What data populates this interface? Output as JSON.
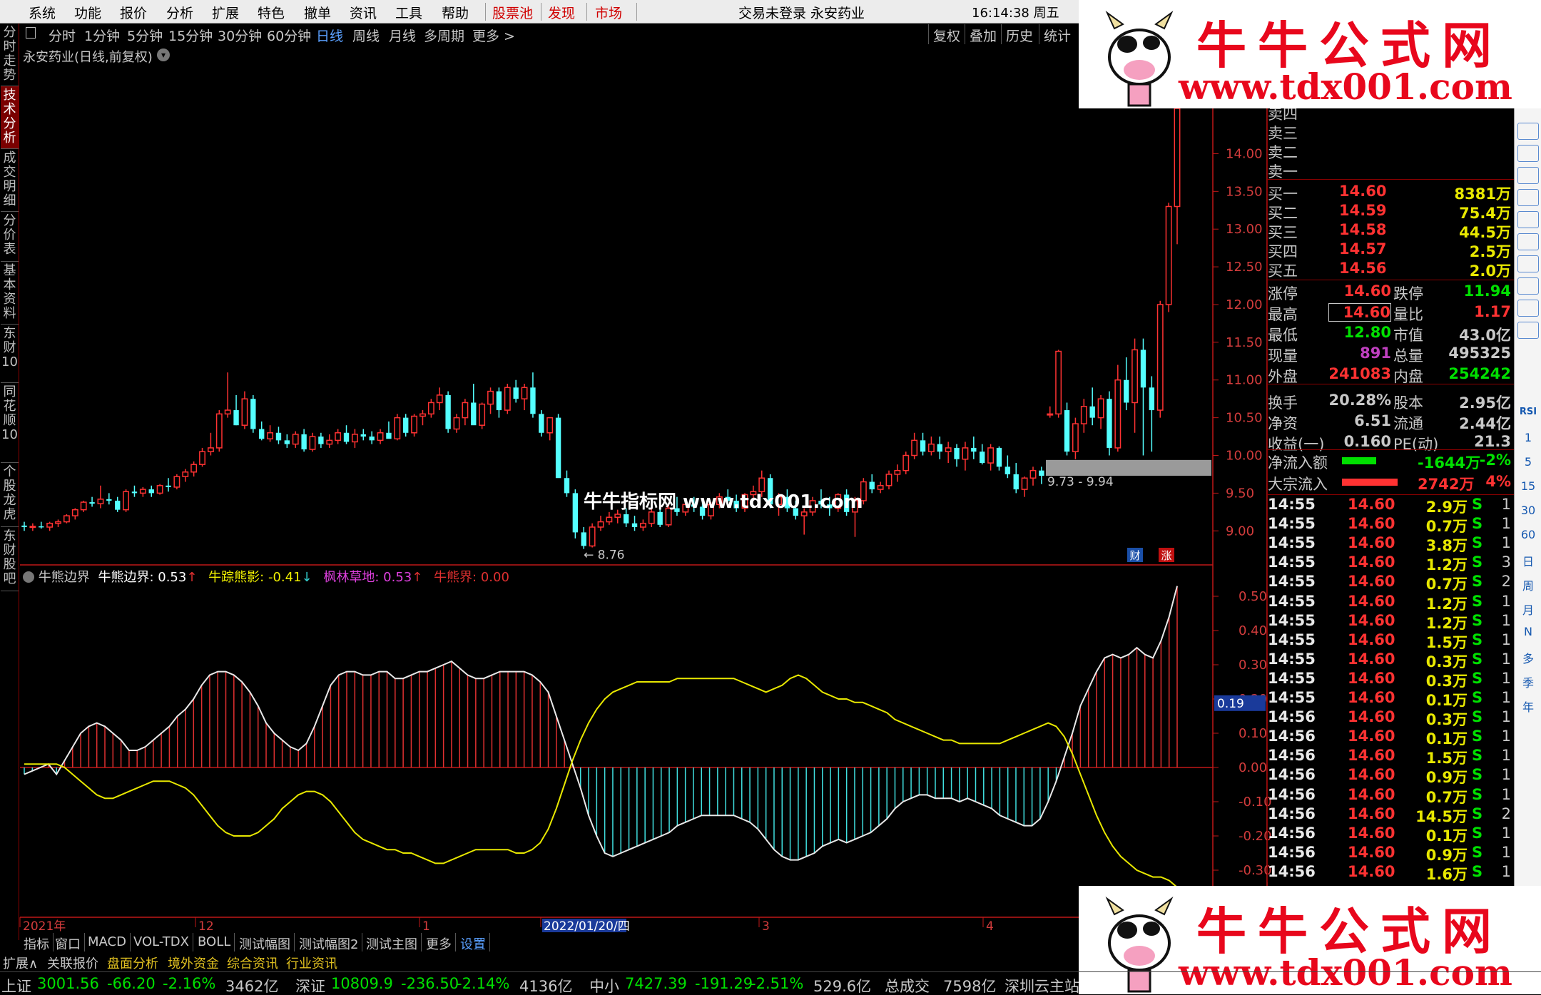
{
  "menu": {
    "items": [
      "系统",
      "功能",
      "报价",
      "分析",
      "扩展",
      "特色",
      "撤单",
      "资讯",
      "工具",
      "帮助"
    ],
    "red_items": [
      "股票池",
      "发现",
      "市场"
    ],
    "title": "交易未登录 永安药业",
    "clock": "16:14:38 周五"
  },
  "periods": [
    "分时",
    "1分钟",
    "5分钟",
    "15分钟",
    "30分钟",
    "60分钟",
    "日线",
    "周线",
    "月线",
    "多周期",
    "更多 >"
  ],
  "active_period": "日线",
  "toolbar_right": [
    "复权",
    "叠加",
    "历史",
    "统计"
  ],
  "left_tabs": [
    "分时走势",
    "技术分析",
    "成交明细",
    "分价表",
    "基本资料",
    "东财10",
    "同花顺10",
    "个股龙虎",
    "东财股吧"
  ],
  "stock_title": "永安药业(日线,前复权)",
  "price_axis": [
    "14.00",
    "13.50",
    "13.00",
    "12.50",
    "12.00",
    "11.50",
    "11.00",
    "10.50",
    "10.00",
    "9.50",
    "9.00"
  ],
  "indicator": {
    "name": "牛熊边界",
    "items": [
      {
        "label": "牛熊边界: 0.53",
        "arrow": "↑"
      },
      {
        "label": "牛踪熊影: -0.41",
        "arrow": "↓"
      },
      {
        "label": "枫林草地: 0.53",
        "arrow": "↑"
      },
      {
        "label": "牛熊界: 0.00",
        "arrow": ""
      }
    ]
  },
  "ind_axis": [
    "0.50",
    "0.40",
    "0.30",
    "0.20",
    "0.10",
    "0.00",
    "-0.10",
    "-0.20",
    "-0.30"
  ],
  "ind_marker": "0.19",
  "low_label": "← 8.76",
  "range_label": "9.73 - 9.94",
  "chart_overlay": "牛牛指标网 www.tdx001.com",
  "badges": {
    "cai": "财",
    "zhang": "涨"
  },
  "date_axis": [
    "2021年",
    "12",
    "1",
    "2022/01/20/四",
    "3",
    "4"
  ],
  "bottom_tabs": [
    "指标",
    "窗口",
    "MACD",
    "VOL-TDX",
    "BOLL",
    "测试幅图",
    "测试幅图2",
    "测试主图",
    "更多",
    "设置"
  ],
  "bottom_tabs2": [
    "扩展∧",
    "关联报价",
    "盘面分析",
    "境外资金",
    "综合资讯",
    "行业资讯"
  ],
  "sell_labels": [
    "卖四",
    "卖三",
    "卖二",
    "卖一"
  ],
  "buy": [
    {
      "label": "买一",
      "price": "14.60",
      "vol": "8381万"
    },
    {
      "label": "买二",
      "price": "14.59",
      "vol": "75.4万"
    },
    {
      "label": "买三",
      "price": "14.58",
      "vol": "44.5万"
    },
    {
      "label": "买四",
      "price": "14.57",
      "vol": "2.5万"
    },
    {
      "label": "买五",
      "price": "14.56",
      "vol": "2.0万"
    }
  ],
  "stats": [
    {
      "l1": "涨停",
      "v1": "14.60",
      "l2": "跌停",
      "v2": "11.94"
    },
    {
      "l1": "最高",
      "v1": "14.60",
      "l2": "量比",
      "v2": "1.17"
    },
    {
      "l1": "最低",
      "v1": "12.80",
      "l2": "市值",
      "v2": "43.0亿"
    },
    {
      "l1": "现量",
      "v1": "891",
      "l2": "总量",
      "v2": "495325"
    },
    {
      "l1": "外盘",
      "v1": "241083",
      "l2": "内盘",
      "v2": "254242"
    },
    {
      "l1": "换手",
      "v1": "20.28%",
      "l2": "股本",
      "v2": "2.95亿"
    },
    {
      "l1": "净资",
      "v1": "6.51",
      "l2": "流通",
      "v2": "2.44亿"
    },
    {
      "l1": "收益(一)",
      "v1": "0.160",
      "l2": "PE(动)",
      "v2": "21.3"
    }
  ],
  "flows": [
    {
      "label": "净流入额",
      "value": "-1644万",
      "pct": "-2%"
    },
    {
      "label": "大宗流入",
      "value": "2742万",
      "pct": "4%"
    }
  ],
  "ticks": [
    {
      "t": "14:55",
      "p": "14.60",
      "v": "2.9万",
      "s": "S",
      "n": "1"
    },
    {
      "t": "14:55",
      "p": "14.60",
      "v": "0.7万",
      "s": "S",
      "n": "1"
    },
    {
      "t": "14:55",
      "p": "14.60",
      "v": "3.8万",
      "s": "S",
      "n": "1"
    },
    {
      "t": "14:55",
      "p": "14.60",
      "v": "1.2万",
      "s": "S",
      "n": "3"
    },
    {
      "t": "14:55",
      "p": "14.60",
      "v": "0.7万",
      "s": "S",
      "n": "2"
    },
    {
      "t": "14:55",
      "p": "14.60",
      "v": "1.2万",
      "s": "S",
      "n": "1"
    },
    {
      "t": "14:55",
      "p": "14.60",
      "v": "1.2万",
      "s": "S",
      "n": "1"
    },
    {
      "t": "14:55",
      "p": "14.60",
      "v": "1.5万",
      "s": "S",
      "n": "1"
    },
    {
      "t": "14:55",
      "p": "14.60",
      "v": "0.3万",
      "s": "S",
      "n": "1"
    },
    {
      "t": "14:55",
      "p": "14.60",
      "v": "0.3万",
      "s": "S",
      "n": "1"
    },
    {
      "t": "14:55",
      "p": "14.60",
      "v": "0.1万",
      "s": "S",
      "n": "1"
    },
    {
      "t": "14:56",
      "p": "14.60",
      "v": "0.3万",
      "s": "S",
      "n": "1"
    },
    {
      "t": "14:56",
      "p": "14.60",
      "v": "0.1万",
      "s": "S",
      "n": "1"
    },
    {
      "t": "14:56",
      "p": "14.60",
      "v": "1.5万",
      "s": "S",
      "n": "1"
    },
    {
      "t": "14:56",
      "p": "14.60",
      "v": "0.9万",
      "s": "S",
      "n": "1"
    },
    {
      "t": "14:56",
      "p": "14.60",
      "v": "0.7万",
      "s": "S",
      "n": "1"
    },
    {
      "t": "14:56",
      "p": "14.60",
      "v": "14.5万",
      "s": "S",
      "n": "2"
    },
    {
      "t": "14:56",
      "p": "14.60",
      "v": "0.1万",
      "s": "S",
      "n": "1"
    },
    {
      "t": "14:56",
      "p": "14.60",
      "v": "0.9万",
      "s": "S",
      "n": "1"
    },
    {
      "t": "14:56",
      "p": "14.60",
      "v": "1.6万",
      "s": "S",
      "n": "1"
    }
  ],
  "right_nav": [
    "RSI",
    "1",
    "5",
    "15",
    "30",
    "60",
    "日",
    "周",
    "月",
    "N",
    "多",
    "季",
    "年"
  ],
  "watermark": {
    "title": "牛牛公式网",
    "url": "www.tdx001.com"
  },
  "status": [
    {
      "name": "上证",
      "val": "3001.56",
      "chg": "-66.20",
      "pct": "-2.16%",
      "amt": "3462亿"
    },
    {
      "name": "深证",
      "val": "10809.9",
      "chg": "-236.50",
      "pct": "-2.14%",
      "amt": "4136亿"
    },
    {
      "name": "中小",
      "val": "7427.39",
      "chg": "-191.29",
      "pct": "-2.51%",
      "amt": "529.6亿"
    }
  ],
  "status_total": {
    "label": "总成交",
    "val": "7598亿"
  },
  "status_server": "深圳云主站",
  "chart_data": {
    "type": "candlestick",
    "title": "永安药业(日线,前复权)",
    "y_range": [
      8.7,
      14.6
    ],
    "candles": [
      [
        9.07,
        9.12,
        9.0,
        9.05
      ],
      [
        9.05,
        9.1,
        9.0,
        9.06
      ],
      [
        9.06,
        9.12,
        9.03,
        9.05
      ],
      [
        9.05,
        9.12,
        9.0,
        9.1
      ],
      [
        9.1,
        9.15,
        9.05,
        9.12
      ],
      [
        9.12,
        9.22,
        9.1,
        9.2
      ],
      [
        9.2,
        9.3,
        9.15,
        9.28
      ],
      [
        9.28,
        9.4,
        9.25,
        9.38
      ],
      [
        9.38,
        9.45,
        9.32,
        9.36
      ],
      [
        9.36,
        9.6,
        9.3,
        9.42
      ],
      [
        9.42,
        9.5,
        9.35,
        9.4
      ],
      [
        9.4,
        9.45,
        9.25,
        9.28
      ],
      [
        9.28,
        9.55,
        9.25,
        9.52
      ],
      [
        9.52,
        9.6,
        9.45,
        9.5
      ],
      [
        9.5,
        9.58,
        9.45,
        9.55
      ],
      [
        9.55,
        9.6,
        9.45,
        9.5
      ],
      [
        9.5,
        9.62,
        9.48,
        9.6
      ],
      [
        9.6,
        9.7,
        9.52,
        9.58
      ],
      [
        9.58,
        9.75,
        9.55,
        9.72
      ],
      [
        9.72,
        9.82,
        9.65,
        9.78
      ],
      [
        9.78,
        9.92,
        9.72,
        9.88
      ],
      [
        9.88,
        10.1,
        9.85,
        10.05
      ],
      [
        10.05,
        10.3,
        10.0,
        10.1
      ],
      [
        10.1,
        10.6,
        10.05,
        10.55
      ],
      [
        10.55,
        11.1,
        10.5,
        10.6
      ],
      [
        10.6,
        10.8,
        10.4,
        10.4
      ],
      [
        10.4,
        10.85,
        10.35,
        10.75
      ],
      [
        10.75,
        10.8,
        10.3,
        10.35
      ],
      [
        10.35,
        10.45,
        10.2,
        10.22
      ],
      [
        10.22,
        10.4,
        10.18,
        10.3
      ],
      [
        10.3,
        10.38,
        10.15,
        10.2
      ],
      [
        10.2,
        10.28,
        10.1,
        10.15
      ],
      [
        10.15,
        10.32,
        10.1,
        10.28
      ],
      [
        10.28,
        10.35,
        10.05,
        10.08
      ],
      [
        10.08,
        10.3,
        10.05,
        10.25
      ],
      [
        10.25,
        10.3,
        10.1,
        10.15
      ],
      [
        10.15,
        10.28,
        10.1,
        10.2
      ],
      [
        10.2,
        10.35,
        10.15,
        10.3
      ],
      [
        10.3,
        10.4,
        10.15,
        10.18
      ],
      [
        10.18,
        10.35,
        10.1,
        10.28
      ],
      [
        10.28,
        10.35,
        10.2,
        10.25
      ],
      [
        10.25,
        10.32,
        10.15,
        10.2
      ],
      [
        10.2,
        10.35,
        10.15,
        10.3
      ],
      [
        10.3,
        10.45,
        10.25,
        10.22
      ],
      [
        10.22,
        10.55,
        10.2,
        10.5
      ],
      [
        10.5,
        10.55,
        10.25,
        10.3
      ],
      [
        10.3,
        10.55,
        10.25,
        10.52
      ],
      [
        10.52,
        10.6,
        10.4,
        10.55
      ],
      [
        10.55,
        10.75,
        10.5,
        10.7
      ],
      [
        10.7,
        10.9,
        10.6,
        10.8
      ],
      [
        10.8,
        10.85,
        10.3,
        10.35
      ],
      [
        10.35,
        10.55,
        10.3,
        10.5
      ],
      [
        10.5,
        10.75,
        10.4,
        10.7
      ],
      [
        10.7,
        10.95,
        10.6,
        10.4
      ],
      [
        10.4,
        10.7,
        10.35,
        10.68
      ],
      [
        10.68,
        10.9,
        10.55,
        10.85
      ],
      [
        10.85,
        10.9,
        10.5,
        10.6
      ],
      [
        10.6,
        10.95,
        10.55,
        10.9
      ],
      [
        10.9,
        11.0,
        10.7,
        10.75
      ],
      [
        10.75,
        10.95,
        10.6,
        10.9
      ],
      [
        10.9,
        11.1,
        10.5,
        10.55
      ],
      [
        10.55,
        10.6,
        10.25,
        10.3
      ],
      [
        10.3,
        10.5,
        10.2,
        10.5
      ],
      [
        10.5,
        10.55,
        9.75,
        9.7
      ],
      [
        9.7,
        9.8,
        9.45,
        9.5
      ],
      [
        9.5,
        9.55,
        8.9,
        8.98
      ],
      [
        8.98,
        9.05,
        8.76,
        8.8
      ],
      [
        8.8,
        9.1,
        8.78,
        9.05
      ],
      [
        9.05,
        9.2,
        9.0,
        9.12
      ],
      [
        9.12,
        9.25,
        9.08,
        9.18
      ],
      [
        9.18,
        9.28,
        9.1,
        9.22
      ],
      [
        9.22,
        9.3,
        9.05,
        9.1
      ],
      [
        9.1,
        9.2,
        9.0,
        9.05
      ],
      [
        9.05,
        9.15,
        9.0,
        9.1
      ],
      [
        9.1,
        9.3,
        9.05,
        9.25
      ],
      [
        9.25,
        9.3,
        9.05,
        9.08
      ],
      [
        9.08,
        9.35,
        9.05,
        9.3
      ],
      [
        9.3,
        9.45,
        9.2,
        9.25
      ],
      [
        9.25,
        9.4,
        9.2,
        9.35
      ],
      [
        9.35,
        9.45,
        9.25,
        9.32
      ],
      [
        9.32,
        9.4,
        9.15,
        9.2
      ],
      [
        9.2,
        9.38,
        9.15,
        9.35
      ],
      [
        9.35,
        9.5,
        9.3,
        9.45
      ],
      [
        9.45,
        9.55,
        9.35,
        9.4
      ],
      [
        9.4,
        9.48,
        9.25,
        9.3
      ],
      [
        9.3,
        9.5,
        9.25,
        9.48
      ],
      [
        9.48,
        9.6,
        9.4,
        9.52
      ],
      [
        9.52,
        9.8,
        9.45,
        9.7
      ],
      [
        9.7,
        9.75,
        9.3,
        9.35
      ],
      [
        9.35,
        9.5,
        9.2,
        9.45
      ],
      [
        9.45,
        9.55,
        9.25,
        9.3
      ],
      [
        9.3,
        9.4,
        9.15,
        9.2
      ],
      [
        9.2,
        9.3,
        8.95,
        9.25
      ],
      [
        9.25,
        9.45,
        9.2,
        9.4
      ],
      [
        9.4,
        9.55,
        9.3,
        9.35
      ],
      [
        9.35,
        9.45,
        9.2,
        9.3
      ],
      [
        9.3,
        9.5,
        9.25,
        9.48
      ],
      [
        9.48,
        9.55,
        9.2,
        9.25
      ],
      [
        9.25,
        9.45,
        8.92,
        9.4
      ],
      [
        9.4,
        9.7,
        9.35,
        9.65
      ],
      [
        9.65,
        9.75,
        9.5,
        9.55
      ],
      [
        9.55,
        9.65,
        9.5,
        9.6
      ],
      [
        9.6,
        9.8,
        9.55,
        9.75
      ],
      [
        9.75,
        9.88,
        9.65,
        9.8
      ],
      [
        9.8,
        10.05,
        9.75,
        10.0
      ],
      [
        10.0,
        10.3,
        9.95,
        10.2
      ],
      [
        10.2,
        10.3,
        10.0,
        10.05
      ],
      [
        10.05,
        10.25,
        10.0,
        10.15
      ],
      [
        10.15,
        10.25,
        9.95,
        10.05
      ],
      [
        10.05,
        10.18,
        9.9,
        10.1
      ],
      [
        10.1,
        10.15,
        9.85,
        9.95
      ],
      [
        9.95,
        10.18,
        9.8,
        10.1
      ],
      [
        10.1,
        10.25,
        9.95,
        10.05
      ],
      [
        10.05,
        10.15,
        9.88,
        9.9
      ],
      [
        9.9,
        10.15,
        9.8,
        10.1
      ],
      [
        10.1,
        10.12,
        9.8,
        9.85
      ],
      [
        9.85,
        10.0,
        9.7,
        9.75
      ],
      [
        9.75,
        9.9,
        9.5,
        9.55
      ],
      [
        9.55,
        9.72,
        9.45,
        9.7
      ],
      [
        9.7,
        9.85,
        9.6,
        9.8
      ],
      [
        9.8,
        9.85,
        9.62,
        9.73
      ],
      [
        10.55,
        10.65,
        10.5,
        10.55
      ],
      [
        10.55,
        11.4,
        10.5,
        11.38
      ],
      [
        10.6,
        10.7,
        10.0,
        10.05
      ],
      [
        10.05,
        10.5,
        9.95,
        10.42
      ],
      [
        10.42,
        10.75,
        10.3,
        10.65
      ],
      [
        10.65,
        10.9,
        10.4,
        10.5
      ],
      [
        10.5,
        10.8,
        10.35,
        10.75
      ],
      [
        10.75,
        10.85,
        10.0,
        10.1
      ],
      [
        10.1,
        11.2,
        10.05,
        11.0
      ],
      [
        11.0,
        11.3,
        10.6,
        10.7
      ],
      [
        10.7,
        11.55,
        10.3,
        11.4
      ],
      [
        11.4,
        11.55,
        10.0,
        10.9
      ],
      [
        10.9,
        11.05,
        10.05,
        10.6
      ],
      [
        10.6,
        12.05,
        10.5,
        12.0
      ],
      [
        12.0,
        13.35,
        11.9,
        13.3
      ],
      [
        13.3,
        14.6,
        12.8,
        14.6
      ]
    ],
    "indicator_bar": [
      -0.02,
      -0.01,
      0.0,
      0.01,
      -0.02,
      0.02,
      0.06,
      0.1,
      0.12,
      0.13,
      0.12,
      0.1,
      0.08,
      0.05,
      0.05,
      0.06,
      0.08,
      0.1,
      0.12,
      0.15,
      0.17,
      0.2,
      0.24,
      0.27,
      0.28,
      0.28,
      0.27,
      0.25,
      0.22,
      0.18,
      0.13,
      0.1,
      0.08,
      0.06,
      0.05,
      0.07,
      0.12,
      0.18,
      0.24,
      0.27,
      0.28,
      0.28,
      0.27,
      0.27,
      0.28,
      0.28,
      0.26,
      0.26,
      0.27,
      0.28,
      0.28,
      0.29,
      0.3,
      0.31,
      0.29,
      0.27,
      0.26,
      0.26,
      0.27,
      0.28,
      0.28,
      0.28,
      0.28,
      0.27,
      0.25,
      0.22,
      0.15,
      0.08,
      0.01,
      -0.06,
      -0.14,
      -0.2,
      -0.25,
      -0.26,
      -0.25,
      -0.24,
      -0.23,
      -0.22,
      -0.21,
      -0.2,
      -0.19,
      -0.17,
      -0.16,
      -0.15,
      -0.14,
      -0.14,
      -0.14,
      -0.14,
      -0.14,
      -0.15,
      -0.16,
      -0.18,
      -0.21,
      -0.24,
      -0.26,
      -0.27,
      -0.27,
      -0.26,
      -0.25,
      -0.23,
      -0.22,
      -0.21,
      -0.22,
      -0.21,
      -0.2,
      -0.19,
      -0.17,
      -0.15,
      -0.12,
      -0.1,
      -0.09,
      -0.08,
      -0.08,
      -0.09,
      -0.09,
      -0.09,
      -0.1,
      -0.09,
      -0.1,
      -0.11,
      -0.12,
      -0.14,
      -0.15,
      -0.16,
      -0.17,
      -0.17,
      -0.15,
      -0.1,
      -0.04,
      0.03,
      0.1,
      0.18,
      0.23,
      0.28,
      0.32,
      0.33,
      0.32,
      0.33,
      0.35,
      0.33,
      0.32,
      0.37,
      0.44,
      0.53
    ],
    "indicator_line": [
      0.01,
      0.01,
      0.01,
      0.01,
      0.01,
      0.0,
      -0.02,
      -0.04,
      -0.06,
      -0.08,
      -0.09,
      -0.09,
      -0.08,
      -0.07,
      -0.06,
      -0.05,
      -0.04,
      -0.04,
      -0.04,
      -0.05,
      -0.06,
      -0.08,
      -0.11,
      -0.14,
      -0.17,
      -0.19,
      -0.2,
      -0.2,
      -0.2,
      -0.19,
      -0.17,
      -0.15,
      -0.12,
      -0.1,
      -0.08,
      -0.07,
      -0.07,
      -0.08,
      -0.1,
      -0.13,
      -0.16,
      -0.19,
      -0.21,
      -0.22,
      -0.23,
      -0.24,
      -0.24,
      -0.25,
      -0.25,
      -0.26,
      -0.27,
      -0.28,
      -0.28,
      -0.27,
      -0.26,
      -0.25,
      -0.24,
      -0.24,
      -0.24,
      -0.24,
      -0.24,
      -0.25,
      -0.25,
      -0.24,
      -0.22,
      -0.18,
      -0.12,
      -0.05,
      0.02,
      0.08,
      0.13,
      0.17,
      0.2,
      0.22,
      0.23,
      0.24,
      0.25,
      0.25,
      0.25,
      0.25,
      0.25,
      0.26,
      0.26,
      0.26,
      0.26,
      0.26,
      0.26,
      0.26,
      0.26,
      0.25,
      0.24,
      0.23,
      0.22,
      0.23,
      0.24,
      0.26,
      0.27,
      0.26,
      0.24,
      0.22,
      0.21,
      0.2,
      0.2,
      0.19,
      0.19,
      0.18,
      0.17,
      0.16,
      0.14,
      0.13,
      0.12,
      0.11,
      0.1,
      0.09,
      0.08,
      0.08,
      0.07,
      0.07,
      0.07,
      0.07,
      0.07,
      0.07,
      0.08,
      0.09,
      0.1,
      0.11,
      0.12,
      0.13,
      0.12,
      0.09,
      0.04,
      -0.02,
      -0.08,
      -0.14,
      -0.19,
      -0.23,
      -0.26,
      -0.28,
      -0.3,
      -0.31,
      -0.32,
      -0.32,
      -0.33,
      -0.35,
      -0.38,
      -0.41
    ]
  }
}
